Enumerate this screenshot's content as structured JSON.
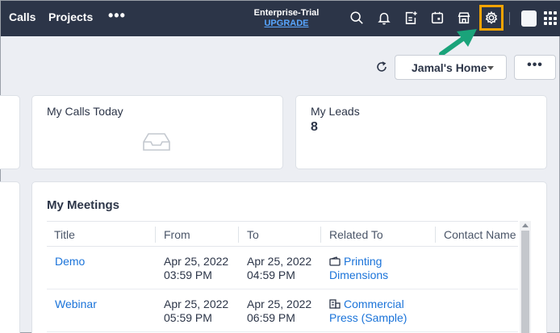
{
  "nav": {
    "calls": "Calls",
    "projects": "Projects",
    "more": "•••",
    "edition": "Enterprise-Trial",
    "upgrade": "UPGRADE",
    "icons": [
      "search-icon",
      "bell-icon",
      "add-record-icon",
      "calendar-icon",
      "marketplace-icon",
      "settings-icon"
    ]
  },
  "toolbar": {
    "home_label": "Jamal's Home",
    "more_label": "•••"
  },
  "cards": {
    "calls_title": "My Calls Today",
    "leads_title": "My Leads",
    "leads_count": "8"
  },
  "meetings": {
    "title": "My Meetings",
    "columns": [
      "Title",
      "From",
      "To",
      "Related To",
      "Contact Name"
    ],
    "rows": [
      {
        "title": "Demo",
        "from_date": "Apr 25, 2022",
        "from_time": "03:59 PM",
        "to_date": "Apr 25, 2022",
        "to_time": "04:59 PM",
        "related_line1": "Printing",
        "related_line2": "Dimensions",
        "related_icon": "deal-icon",
        "contact": ""
      },
      {
        "title": "Webinar",
        "from_date": "Apr 25, 2022",
        "from_time": "05:59 PM",
        "to_date": "Apr 25, 2022",
        "to_time": "06:59 PM",
        "related_line1": "Commercial",
        "related_line2": "Press (Sample)",
        "related_icon": "building-icon",
        "contact": ""
      }
    ]
  },
  "colors": {
    "nav_bg": "#2c3548",
    "highlight": "#f5a300",
    "arrow": "#1aa37a",
    "link": "#1a73d9"
  }
}
